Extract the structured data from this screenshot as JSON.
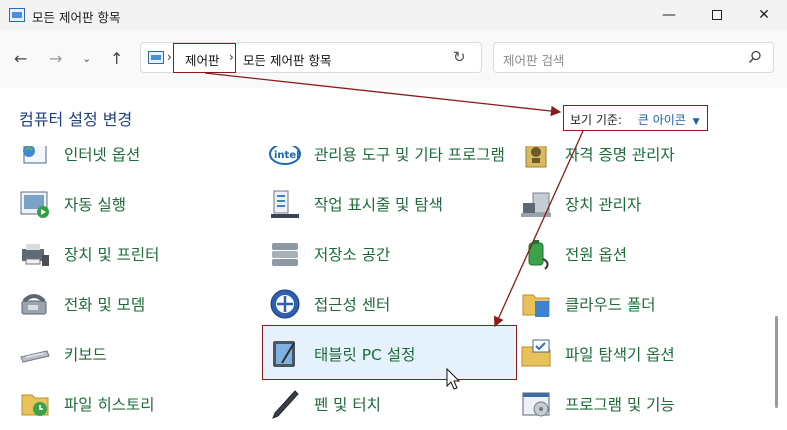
{
  "window": {
    "title": "모든 제어판 항목",
    "minimize_glyph": "—",
    "close_glyph": "✕"
  },
  "nav": {
    "back_glyph": "←",
    "forward_glyph": "→",
    "recent_glyph": "⌄",
    "up_glyph": "↑",
    "separator": "›",
    "breadcrumbs": [
      "제어판",
      "모든 제어판 항목"
    ],
    "refresh_glyph": "↻",
    "search_placeholder": "제어판 검색"
  },
  "header": {
    "title": "컴퓨터 설정 변경",
    "view_by_label": "보기 기준:",
    "view_by_value": "큰 아이콘",
    "view_by_caret": "▼"
  },
  "items": {
    "col1": [
      "인터넷 옵션",
      "자동 실행",
      "장치 및 프린터",
      "전화 및 모뎀",
      "키보드",
      "파일 히스토리"
    ],
    "col2": [
      "관리용 도구 및 기타 프로그램",
      "작업 표시줄 및 탐색",
      "저장소 공간",
      "접근성 센터",
      "태블릿 PC 설정",
      "펜 및 터치"
    ],
    "col3": [
      "자격 증명 관리자",
      "장치 관리자",
      "전원 옵션",
      "클라우드 폴더",
      "파일 탐색기 옵션",
      "프로그램 및 기능"
    ]
  },
  "icons": {
    "col1": [
      "internet-options-icon",
      "autoplay-icon",
      "devices-printers-icon",
      "phone-modem-icon",
      "keyboard-icon",
      "file-history-icon"
    ],
    "col2": [
      "intel-graphics-icon",
      "taskbar-icon",
      "storage-spaces-icon",
      "ease-of-access-icon",
      "tablet-pc-icon",
      "pen-touch-icon"
    ],
    "col3": [
      "credential-manager-icon",
      "device-manager-icon",
      "power-options-icon",
      "work-folders-icon",
      "file-explorer-options-icon",
      "programs-features-icon"
    ]
  },
  "colors": {
    "link_green": "#1c6b3a",
    "title_blue": "#1f3f80",
    "annotation_red": "#8b1a1a",
    "selection_blue": "#e5f1fb"
  }
}
